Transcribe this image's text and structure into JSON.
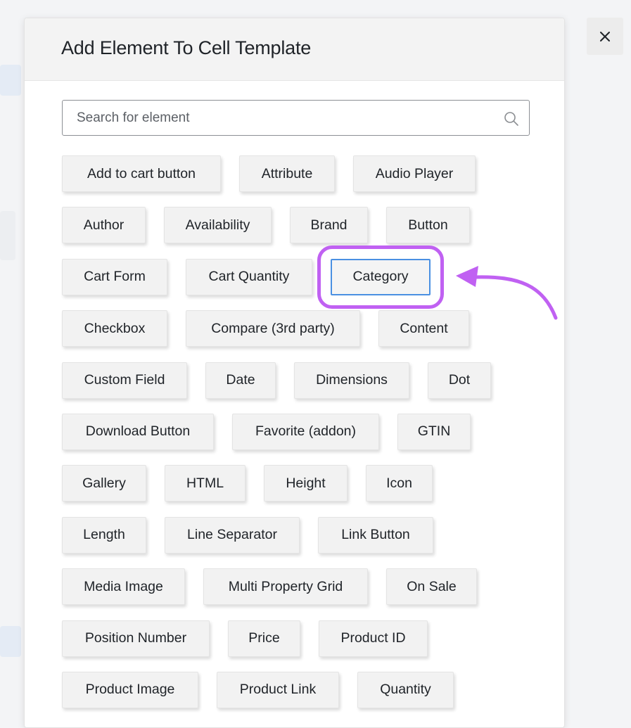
{
  "modal": {
    "title": "Add Element To Cell Template",
    "close_label": "×"
  },
  "search": {
    "placeholder": "Search for element",
    "value": ""
  },
  "elements": [
    [
      "Add to cart button",
      "Attribute",
      "Audio Player"
    ],
    [
      "Author",
      "Availability",
      "Brand",
      "Button"
    ],
    [
      "Cart Form",
      "Cart Quantity",
      "Category"
    ],
    [
      "Checkbox",
      "Compare (3rd party)",
      "Content"
    ],
    [
      "Custom Field",
      "Date",
      "Dimensions",
      "Dot"
    ],
    [
      "Download Button",
      "Favorite (addon)",
      "GTIN"
    ],
    [
      "Gallery",
      "HTML",
      "Height",
      "Icon"
    ],
    [
      "Length",
      "Line Separator",
      "Link Button"
    ],
    [
      "Media Image",
      "Multi Property Grid",
      "On Sale"
    ],
    [
      "Position Number",
      "Price",
      "Product ID"
    ],
    [
      "Product Image",
      "Product Link",
      "Quantity"
    ]
  ],
  "highlighted_element": "Category",
  "colors": {
    "highlight_outline": "#c061f2",
    "selected_border": "#4a90e2",
    "arrow": "#c061f2"
  },
  "icons": {
    "search": "search-icon",
    "close": "close-icon",
    "annotation_arrow": "curved-arrow-icon"
  }
}
